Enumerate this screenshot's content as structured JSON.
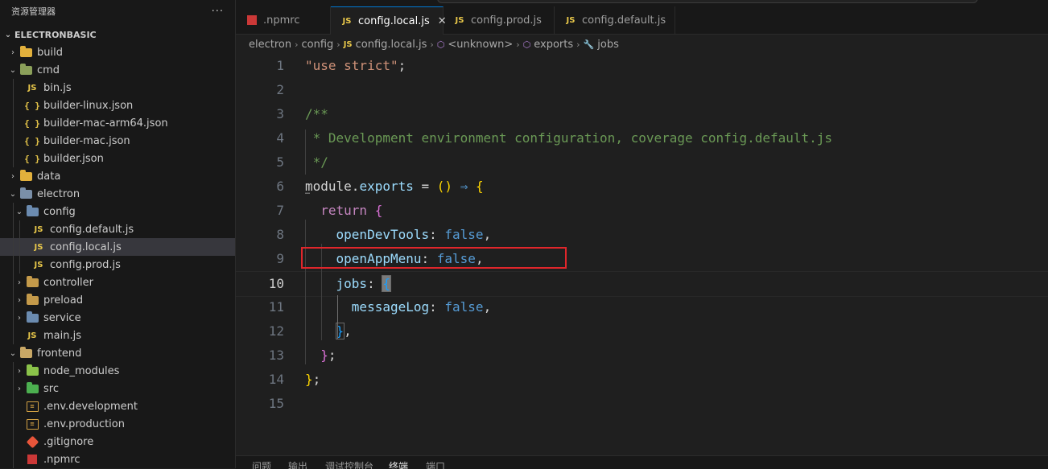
{
  "sidebar": {
    "title": "资源管理器",
    "more": "···",
    "section": "ELECTRONBASIC",
    "items": [
      {
        "label": "build",
        "depth": 0,
        "kind": "folder",
        "color": "#e2b03c",
        "twisty": "›"
      },
      {
        "label": "cmd",
        "depth": 0,
        "kind": "folder",
        "color": "#8ba05a",
        "twisty": "⌄"
      },
      {
        "label": "bin.js",
        "depth": 1,
        "kind": "js"
      },
      {
        "label": "builder-linux.json",
        "depth": 1,
        "kind": "json"
      },
      {
        "label": "builder-mac-arm64.json",
        "depth": 1,
        "kind": "json"
      },
      {
        "label": "builder-mac.json",
        "depth": 1,
        "kind": "json"
      },
      {
        "label": "builder.json",
        "depth": 1,
        "kind": "json"
      },
      {
        "label": "data",
        "depth": 0,
        "kind": "folder",
        "color": "#e2b03c",
        "twisty": "›"
      },
      {
        "label": "electron",
        "depth": 0,
        "kind": "folder",
        "color": "#7a8fa8",
        "twisty": "⌄"
      },
      {
        "label": "config",
        "depth": 1,
        "kind": "folder",
        "color": "#6b8bb0",
        "twisty": "⌄"
      },
      {
        "label": "config.default.js",
        "depth": 2,
        "kind": "js"
      },
      {
        "label": "config.local.js",
        "depth": 2,
        "kind": "js",
        "selected": true
      },
      {
        "label": "config.prod.js",
        "depth": 2,
        "kind": "js"
      },
      {
        "label": "controller",
        "depth": 1,
        "kind": "folder",
        "color": "#c49a4a",
        "twisty": "›"
      },
      {
        "label": "preload",
        "depth": 1,
        "kind": "folder",
        "color": "#c49a4a",
        "twisty": "›"
      },
      {
        "label": "service",
        "depth": 1,
        "kind": "folder",
        "color": "#6b8bb0",
        "twisty": "›"
      },
      {
        "label": "main.js",
        "depth": 1,
        "kind": "js"
      },
      {
        "label": "frontend",
        "depth": 0,
        "kind": "folder",
        "color": "#c9a866",
        "twisty": "⌄"
      },
      {
        "label": "node_modules",
        "depth": 1,
        "kind": "folder",
        "color": "#8bc34a",
        "twisty": "›"
      },
      {
        "label": "src",
        "depth": 1,
        "kind": "folder",
        "color": "#4caf50",
        "twisty": "›"
      },
      {
        "label": ".env.development",
        "depth": 1,
        "kind": "env"
      },
      {
        "label": ".env.production",
        "depth": 1,
        "kind": "env"
      },
      {
        "label": ".gitignore",
        "depth": 1,
        "kind": "git"
      },
      {
        "label": ".npmrc",
        "depth": 1,
        "kind": "npmrc"
      }
    ]
  },
  "tabs": [
    {
      "label": ".npmrc",
      "kind": "npmrc",
      "active": false
    },
    {
      "label": "config.local.js",
      "kind": "js",
      "active": true,
      "close": "✕"
    },
    {
      "label": "config.prod.js",
      "kind": "js",
      "active": false
    },
    {
      "label": "config.default.js",
      "kind": "js",
      "active": false
    }
  ],
  "icons": {
    "js": "JS",
    "json": "{ }",
    "env": "≡"
  },
  "breadcrumb": [
    {
      "label": "electron",
      "icon": ""
    },
    {
      "label": "config",
      "icon": ""
    },
    {
      "label": "config.local.js",
      "icon": "JS"
    },
    {
      "label": "<unknown>",
      "icon": "⬡"
    },
    {
      "label": "exports",
      "icon": "⬡"
    },
    {
      "label": "jobs",
      "icon": "🔧"
    }
  ],
  "breadcrumb_sep": "›",
  "editor": {
    "current_line": 10,
    "lines": [
      {
        "n": "1",
        "tokens": [
          [
            "str",
            "\"use strict\""
          ],
          [
            "op",
            ";"
          ]
        ]
      },
      {
        "n": "2",
        "tokens": []
      },
      {
        "n": "3",
        "tokens": [
          [
            "cmt",
            "/**"
          ]
        ]
      },
      {
        "n": "4",
        "tokens": [
          [
            "cmt",
            " * Development environment configuration, coverage config.default.js"
          ]
        ]
      },
      {
        "n": "5",
        "tokens": [
          [
            "cmt",
            " */"
          ]
        ]
      },
      {
        "n": "6",
        "tokens": [
          [
            "op",
            "module"
          ],
          [
            "op",
            "."
          ],
          [
            "obj",
            "exports"
          ],
          [
            "op",
            " = "
          ],
          [
            "b1",
            "()"
          ],
          [
            "op",
            " "
          ],
          [
            "const",
            "⇒"
          ],
          [
            "op",
            " "
          ],
          [
            "b1",
            "{"
          ]
        ]
      },
      {
        "n": "7",
        "tokens": [
          [
            "op",
            "  "
          ],
          [
            "kw",
            "return"
          ],
          [
            "op",
            " "
          ],
          [
            "b2",
            "{"
          ]
        ]
      },
      {
        "n": "8",
        "tokens": [
          [
            "op",
            "    "
          ],
          [
            "prop",
            "openDevTools"
          ],
          [
            "op",
            ": "
          ],
          [
            "const",
            "false"
          ],
          [
            "op",
            ","
          ]
        ]
      },
      {
        "n": "9",
        "tokens": [
          [
            "op",
            "    "
          ],
          [
            "prop",
            "openAppMenu"
          ],
          [
            "op",
            ": "
          ],
          [
            "const",
            "false"
          ],
          [
            "op",
            ","
          ]
        ]
      },
      {
        "n": "10",
        "tokens": [
          [
            "op",
            "    "
          ],
          [
            "prop",
            "jobs"
          ],
          [
            "op",
            ": "
          ],
          [
            "cursor",
            "{"
          ]
        ]
      },
      {
        "n": "11",
        "tokens": [
          [
            "op",
            "      "
          ],
          [
            "prop",
            "messageLog"
          ],
          [
            "op",
            ": "
          ],
          [
            "const",
            "false"
          ],
          [
            "op",
            ","
          ]
        ]
      },
      {
        "n": "12",
        "tokens": [
          [
            "op",
            "    "
          ],
          [
            "match",
            "}"
          ],
          [
            "op",
            ","
          ]
        ]
      },
      {
        "n": "13",
        "tokens": [
          [
            "op",
            "  "
          ],
          [
            "b2",
            "}"
          ],
          [
            "op",
            ";"
          ]
        ]
      },
      {
        "n": "14",
        "tokens": [
          [
            "b1",
            "}"
          ],
          [
            "op",
            ";"
          ]
        ]
      },
      {
        "n": "15",
        "tokens": []
      }
    ],
    "fold_marker": "…"
  },
  "panel": {
    "tabs": [
      {
        "label": "问题",
        "active": false
      },
      {
        "label": "输出",
        "active": false
      },
      {
        "label": "调试控制台",
        "active": false
      },
      {
        "label": "终端",
        "active": true
      },
      {
        "label": "端口",
        "active": false
      }
    ]
  }
}
